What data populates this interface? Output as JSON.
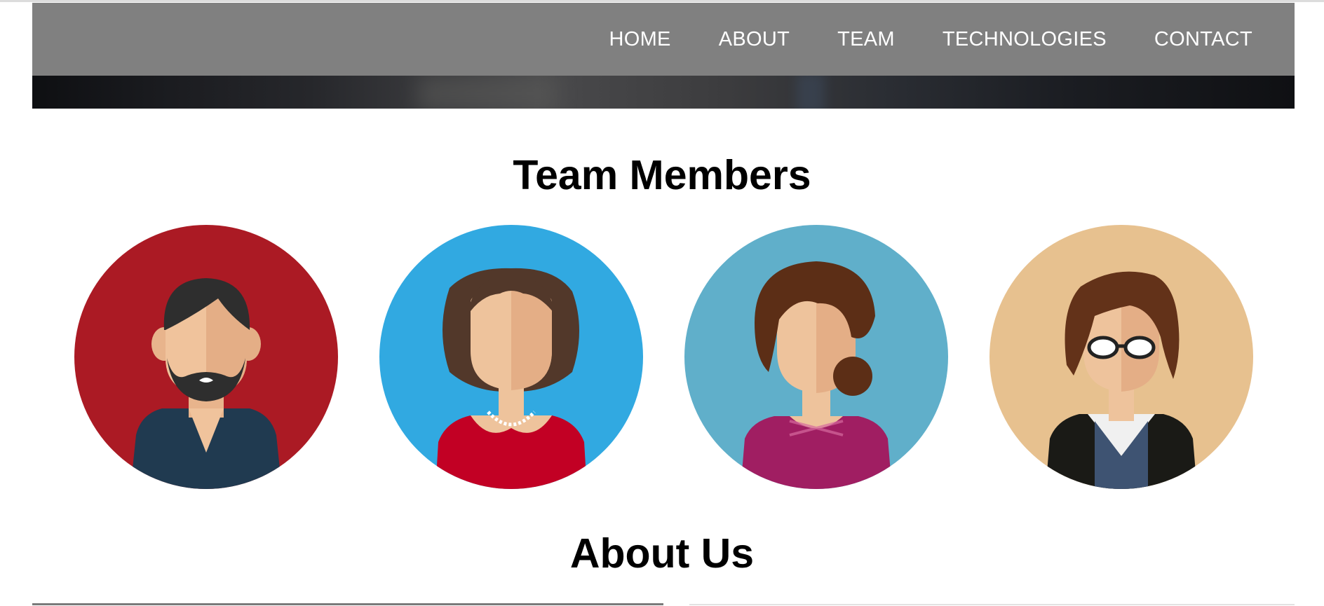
{
  "nav": {
    "items": [
      "HOME",
      "ABOUT",
      "TEAM",
      "TECHNOLOGIES",
      "CONTACT"
    ]
  },
  "team": {
    "title": "Team Members",
    "members": [
      {
        "avatar_icon": "bearded-man-avatar-icon",
        "bg_color": "#ab1a24"
      },
      {
        "avatar_icon": "woman-pearl-necklace-avatar-icon",
        "bg_color": "#31a9e1"
      },
      {
        "avatar_icon": "woman-side-bun-avatar-icon",
        "bg_color": "#60afca"
      },
      {
        "avatar_icon": "glasses-person-avatar-icon",
        "bg_color": "#e7c18f"
      }
    ]
  },
  "about": {
    "title": "About Us"
  },
  "colors": {
    "nav_bg": "#808080",
    "nav_text": "#ffffff"
  }
}
